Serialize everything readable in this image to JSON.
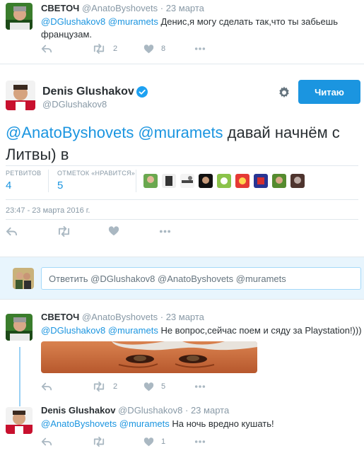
{
  "tweet_top": {
    "name": "СВЕТОЧ",
    "handle": "@AnatoByshovets",
    "date": "23 марта",
    "text_mentions": "@DGlushakov8 @muramets",
    "text_body": " Денис,я могу сделать так,что ты забьешь",
    "text_line2": "французам.",
    "retweets": "2",
    "likes": "8"
  },
  "main_tweet": {
    "name": "Denis Glushakov",
    "handle": "@DGlushakov8",
    "follow_label": "Читаю",
    "text_mentions": "@AnatoByshovets @muramets",
    "text_body": "  давай начнём с Литвы) в",
    "retweets_label": "РЕТВИТОВ",
    "retweets_value": "4",
    "likes_label": "ОТМЕТОК «НРАВИТСЯ»",
    "likes_value": "5",
    "datetime": "23:47 - 23 марта 2016 г."
  },
  "reply_box": {
    "placeholder": "Ответить @DGlushakov8 @AnatoByshovets @muramets"
  },
  "reply1": {
    "name": "СВЕТОЧ",
    "handle": "@AnatoByshovets",
    "date": "23 марта",
    "text_mentions": "@DGlushakov8 @muramets",
    "text_body": " Не вопрос,сейчас поем и сяду за Playstation!)))",
    "retweets": "2",
    "likes": "5"
  },
  "reply2": {
    "name": "Denis Glushakov",
    "handle": "@DGlushakov8",
    "date": "23 марта",
    "text_mentions": "@AnatoByshovets @muramets",
    "text_body": "  На ночь вредно кушать!",
    "likes": "1"
  },
  "separator": "·",
  "colors": {
    "accent": "#1b95e0",
    "muted": "#8899a6",
    "icon": "#aab8c2",
    "reply_bg": "#e8f5fd",
    "thread_line": "#9ad1f5"
  }
}
